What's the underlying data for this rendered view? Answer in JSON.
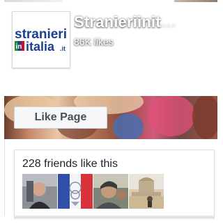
{
  "header": {
    "page_name": "Stranieriinit",
    "page_name_fade": "…",
    "likes_count": "86K likes"
  },
  "logo": {
    "line1": "stranieri",
    "prefix": "in",
    "line2": "italia",
    "suffix": ".it",
    "colors": {
      "blue": "#1b3f8f",
      "red": "#c8102e",
      "green": "#2a8a3a"
    }
  },
  "actions": {
    "like_page_label": "Like Page"
  },
  "friends": {
    "summary": "228 friends like this",
    "thumbnails": [
      {
        "name": "friend-photo-1"
      },
      {
        "name": "friend-photo-2"
      },
      {
        "name": "friend-photo-3"
      },
      {
        "name": "friend-photo-4"
      }
    ]
  }
}
